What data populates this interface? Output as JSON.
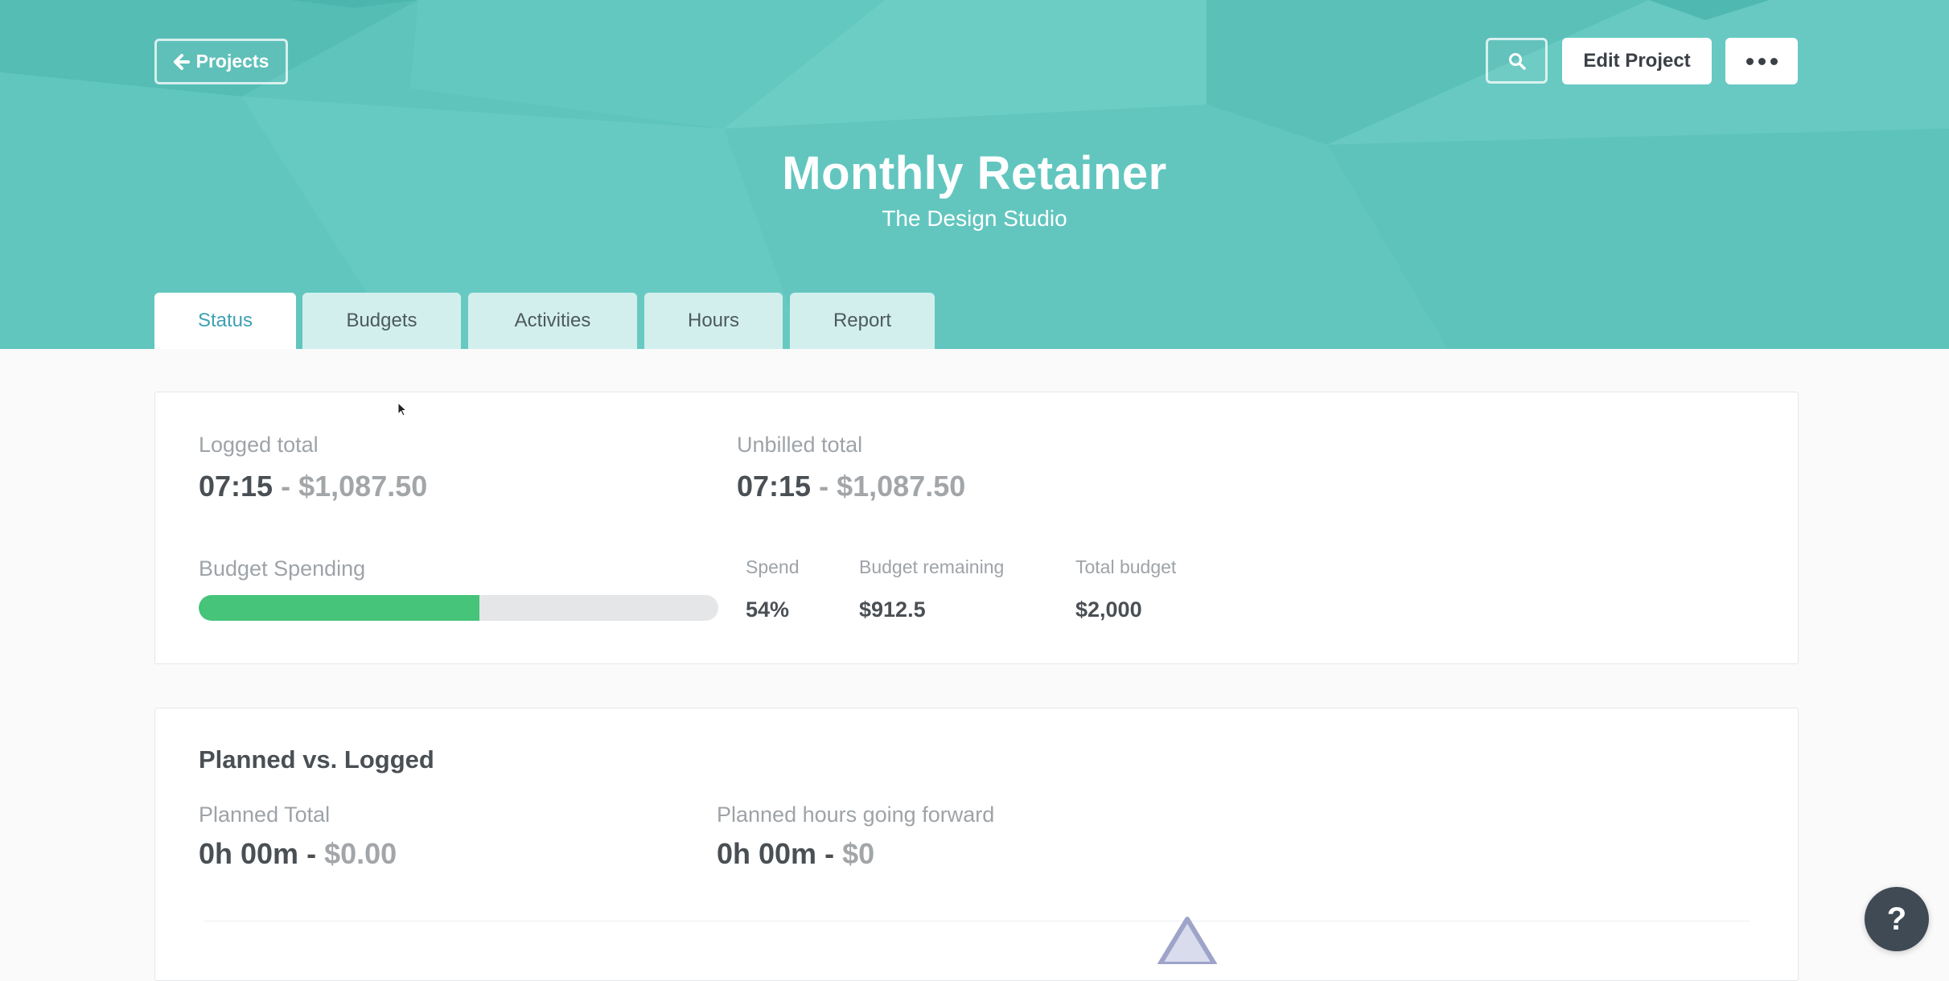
{
  "header": {
    "back_label": "Projects",
    "edit_label": "Edit Project",
    "title": "Monthly Retainer",
    "subtitle": "The Design Studio",
    "icons": {
      "back": "arrow-left-icon",
      "search": "search-icon",
      "more": "more-dots-icon"
    },
    "colors": {
      "header_bg": "#5ec4bc",
      "active_tab_text": "#3ea1b3"
    }
  },
  "tabs": [
    {
      "label": "Status",
      "active": true
    },
    {
      "label": "Budgets",
      "active": false
    },
    {
      "label": "Activities",
      "active": false
    },
    {
      "label": "Hours",
      "active": false
    },
    {
      "label": "Report",
      "active": false
    }
  ],
  "summary": {
    "logged": {
      "label": "Logged total",
      "time": "07:15",
      "separator": "-",
      "amount": "$1,087.50"
    },
    "unbilled": {
      "label": "Unbilled total",
      "time": "07:15",
      "separator": "-",
      "amount": "$1,087.50"
    },
    "budget": {
      "label": "Budget Spending",
      "progress_percent": 54,
      "progress_color": "#45c47a",
      "spend_label": "Spend",
      "spend_value": "54%",
      "remaining_label": "Budget remaining",
      "remaining_value": "$912.5",
      "total_label": "Total budget",
      "total_value": "$2,000"
    }
  },
  "planned": {
    "title": "Planned vs. Logged",
    "planned_total": {
      "label": "Planned Total",
      "time": "0h 00m",
      "separator": "-",
      "amount": "$0.00"
    },
    "planned_forward": {
      "label": "Planned hours going forward",
      "time": "0h 00m",
      "separator": "-",
      "amount": "$0"
    }
  },
  "help": {
    "label": "?",
    "icon": "help-icon"
  }
}
